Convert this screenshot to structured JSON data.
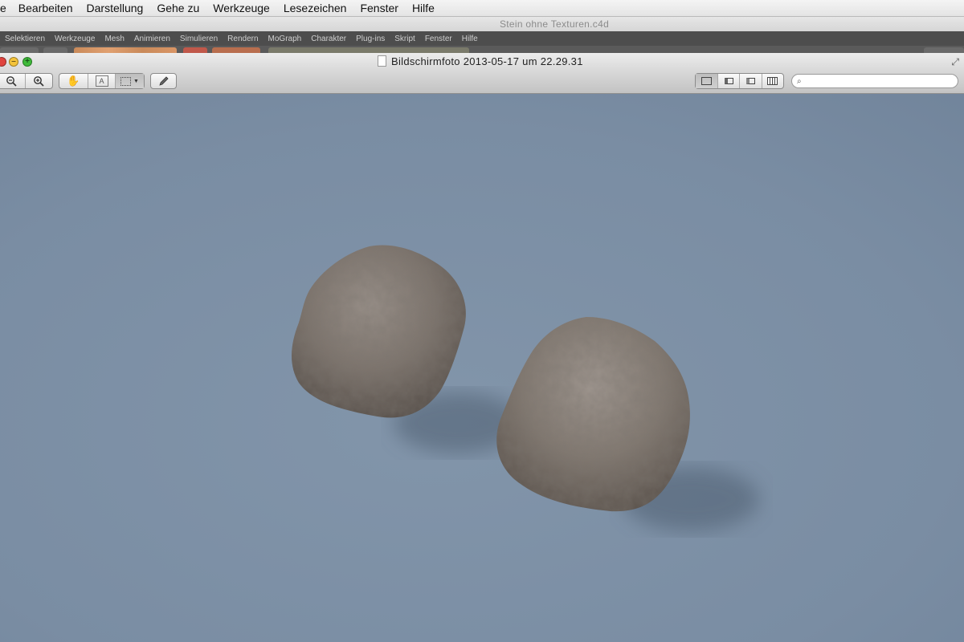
{
  "mac_menu": [
    "e",
    "Bearbeiten",
    "Darstellung",
    "Gehe zu",
    "Werkzeuge",
    "Lesezeichen",
    "Fenster",
    "Hilfe"
  ],
  "c4d": {
    "document_title": "Stein ohne Texturen.c4d",
    "menu": [
      "Selektieren",
      "Werkzeuge",
      "Mesh",
      "Animieren",
      "Simulieren",
      "Rendern",
      "MoGraph",
      "Charakter",
      "Plug-ins",
      "Skript",
      "Fenster",
      "Hilfe"
    ]
  },
  "preview": {
    "title": "Bildschirmfoto 2013-05-17 um 22.29.31",
    "search": {
      "value": "",
      "placeholder": ""
    },
    "icons": {
      "close": "close-icon",
      "minimize": "minimize-icon",
      "zoom": "zoom-icon",
      "zoom_out": "zoom-out-icon",
      "zoom_in": "zoom-in-icon",
      "move": "hand-icon",
      "text_select": "text-select-icon",
      "rect_select": "rect-select-icon",
      "annotate": "pencil-icon",
      "single_page": "single-page-icon",
      "sidebar_thumbs": "thumbnail-sidebar-icon",
      "sidebar_toc": "toc-sidebar-icon",
      "contact_sheet": "contact-sheet-icon",
      "search": "search-icon"
    }
  },
  "colors": {
    "background": "#7d8fa3",
    "rock": "#7a716a",
    "c4d_menu_bg": "#4d4d4d"
  }
}
